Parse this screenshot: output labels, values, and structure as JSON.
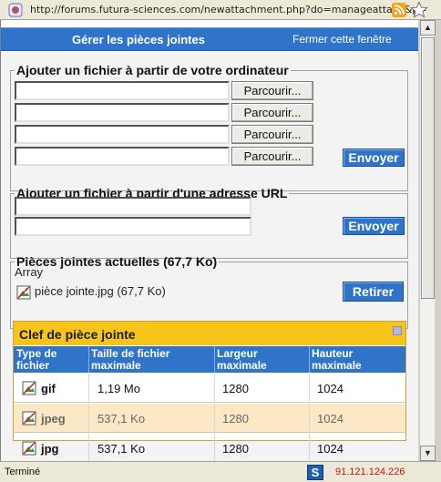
{
  "browser": {
    "url": "http://forums.futura-sciences.com/newattachment.php?do=manageattach&p=",
    "status": "Terminé",
    "ip": "91.121.124.226",
    "s_icon_label": "S"
  },
  "dialog": {
    "title": "Gérer les pièces jointes",
    "close_label": "Fermer cette fenêtre"
  },
  "upload_computer": {
    "legend": "Ajouter un fichier à partir de votre ordinateur",
    "browse_label": "Parcourir...",
    "file_fields": [
      "",
      "",
      "",
      ""
    ],
    "send_label": "Envoyer"
  },
  "upload_url": {
    "legend": "Ajouter un fichier à partir d'une adresse URL",
    "url_fields": [
      "",
      ""
    ],
    "send_label": "Envoyer"
  },
  "current": {
    "legend": "Pièces jointes actuelles (67,7 Ko)",
    "array_text": "Array",
    "attachment": "pièce jointe.jpg (67,7 Ko)",
    "remove_label": "Retirer"
  },
  "key": {
    "title": "Clef de pièce jointe",
    "headers": {
      "type": [
        "Type de",
        "fichier"
      ],
      "size": [
        "Taille de fichier",
        "maximale"
      ],
      "width": [
        "Largeur",
        "maximale"
      ],
      "height": [
        "Hauteur",
        "maximale"
      ]
    },
    "rows": [
      {
        "type": "gif",
        "size": "1,19 Mo",
        "width": "1280",
        "height": "1024"
      },
      {
        "type": "jpeg",
        "size": "537,1 Ko",
        "width": "1280",
        "height": "1024"
      },
      {
        "type": "jpg",
        "size": "537,1 Ko",
        "width": "1280",
        "height": "1024"
      }
    ]
  },
  "colors": {
    "dialog_blue": "#2f74c9",
    "key_header_yellow": "#f7c41a",
    "alt_row": "#fde8c6",
    "ip_red": "#cc1111"
  }
}
